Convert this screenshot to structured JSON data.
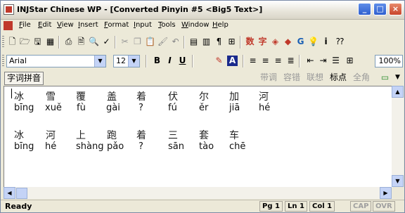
{
  "window": {
    "title": "INJStar Chinese WP - [Converted Pinyin #5 <Big5 Text>]",
    "controls": [
      "_",
      "□",
      "×"
    ]
  },
  "menu": [
    "File",
    "Edit",
    "View",
    "Insert",
    "Format",
    "Input",
    "Tools",
    "Window",
    "Help"
  ],
  "toolbar": {
    "chinese_label": "数",
    "chinese_label2": "字"
  },
  "format": {
    "font": "Arial",
    "size": "12",
    "bold": "B",
    "italic": "I",
    "underline": "U",
    "zoom": "100%"
  },
  "inputbar": {
    "mode": "字词拼音",
    "buttons": [
      "带调",
      "容错",
      "联想",
      "标点",
      "全角"
    ]
  },
  "document": {
    "line1_hanzi": [
      "冰",
      "雪",
      "覆",
      "盖",
      "着",
      "伏",
      "尔",
      "加",
      "河"
    ],
    "line1_pinyin": [
      "bīng",
      "xuě",
      "fù",
      "gài",
      "?",
      "fú",
      "ěr",
      "jiā",
      "hé"
    ],
    "line2_hanzi": [
      "冰",
      "河",
      "上",
      "跑",
      "着",
      "三",
      "套",
      "车"
    ],
    "line2_pinyin": [
      "bīng",
      "hé",
      "shàng",
      "pǎo",
      "?",
      "sān",
      "tào",
      "chē"
    ]
  },
  "status": {
    "ready": "Ready",
    "page": "Pg 1",
    "line": "Ln 1",
    "col": "Col 1",
    "cap": "CAP",
    "ovr": "OVR"
  }
}
